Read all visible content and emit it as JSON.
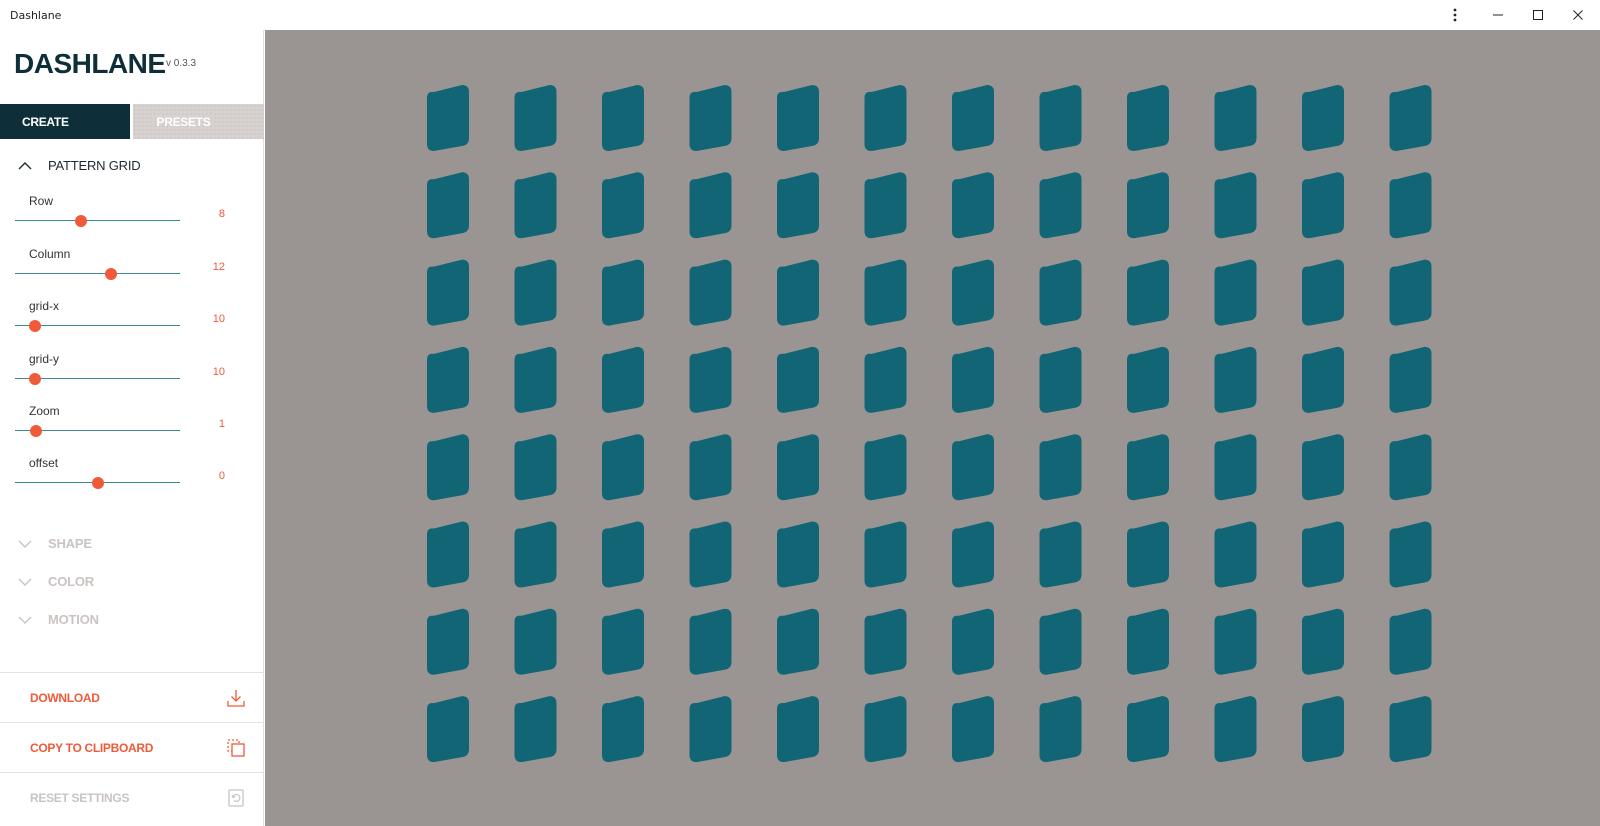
{
  "window": {
    "title": "Dashlane"
  },
  "sidebar": {
    "brand": "DASHLANE",
    "version": "v 0.3.3",
    "tabs": [
      {
        "label": "CREATE"
      },
      {
        "label": "PRESETS"
      }
    ],
    "pattern_grid": {
      "title": "PATTERN GRID",
      "sliders": [
        {
          "label": "Row",
          "value": "8",
          "fraction": 0.4
        },
        {
          "label": "Column",
          "value": "12",
          "fraction": 0.58
        },
        {
          "label": "grid-x",
          "value": "10",
          "fraction": 0.12
        },
        {
          "label": "grid-y",
          "value": "10",
          "fraction": 0.12
        },
        {
          "label": "Zoom",
          "value": "1",
          "fraction": 0.13
        },
        {
          "label": "offset",
          "value": "0",
          "fraction": 0.5
        }
      ]
    },
    "sections": [
      {
        "title": "SHAPE"
      },
      {
        "title": "COLOR"
      },
      {
        "title": "MOTION"
      }
    ],
    "actions": {
      "download": "DOWNLOAD",
      "copy": "COPY TO CLIPBOARD",
      "reset": "RESET SETTINGS"
    }
  },
  "canvas": {
    "rows": 8,
    "columns": 12,
    "background": "#9a9592",
    "shape_color": "#126575"
  },
  "colors": {
    "accent": "#f05a38",
    "dark": "#0e2f3a",
    "track": "#3b8a97",
    "disabled": "#c9c4c2"
  }
}
